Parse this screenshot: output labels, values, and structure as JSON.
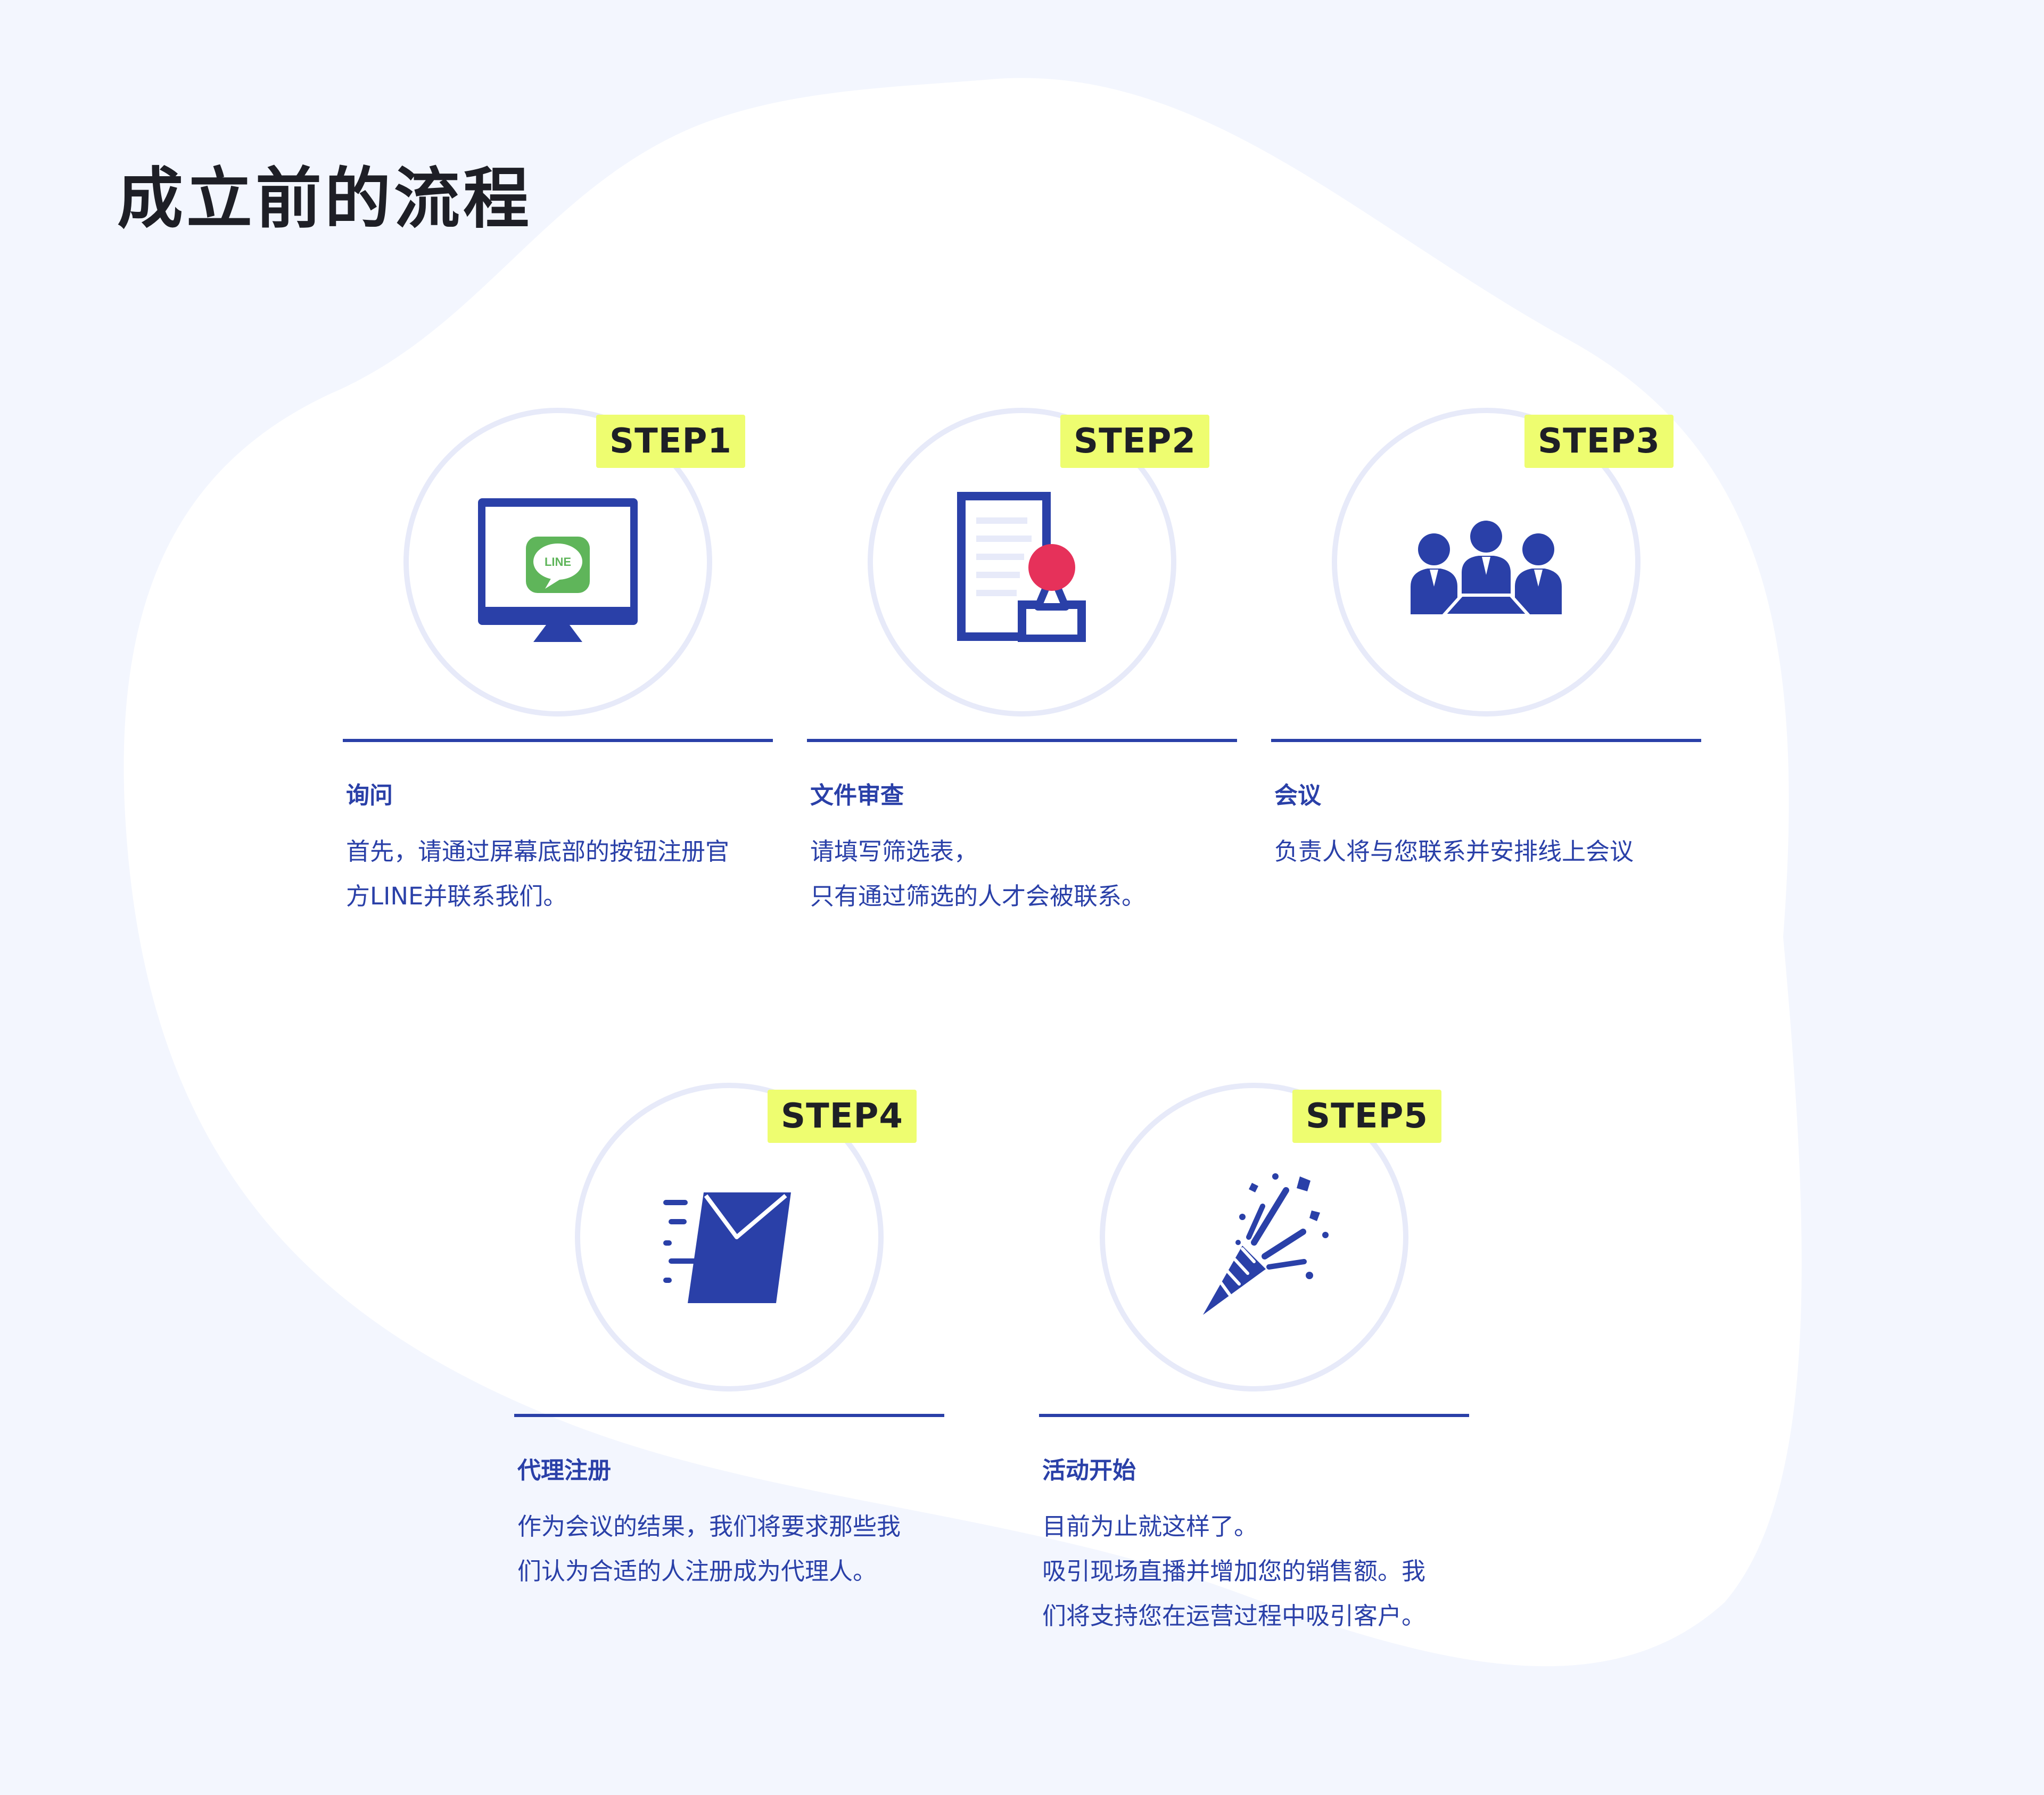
{
  "page": {
    "title": "成立前的流程"
  },
  "colors": {
    "background": "#f3f6fe",
    "blob": "#ffffff",
    "ring": "#e7eaf9",
    "accent_blue": "#2a40a8",
    "tag_yellow": "#eefd70",
    "line_green": "#5fb55a",
    "stamp_red": "#e6315a",
    "heading_dark": "#1e1f26"
  },
  "steps": [
    {
      "tag": "STEP1",
      "icon": "monitor-line-icon",
      "icon_text": "LINE",
      "title": "询问",
      "description": [
        "首先，请通过屏幕底部的按钮注册官",
        "方LINE并联系我们。"
      ]
    },
    {
      "tag": "STEP2",
      "icon": "document-stamp-icon",
      "title": "文件审查",
      "description": [
        "请填写筛选表，",
        "只有通过筛选的人才会被联系。"
      ]
    },
    {
      "tag": "STEP3",
      "icon": "meeting-people-icon",
      "title": "会议",
      "description": [
        "负责人将与您联系并安排线上会议"
      ]
    },
    {
      "tag": "STEP4",
      "icon": "sending-mail-icon",
      "title": "代理注册",
      "description": [
        "作为会议的结果，我们将要求那些我",
        "们认为合适的人注册成为代理人。"
      ]
    },
    {
      "tag": "STEP5",
      "icon": "party-popper-icon",
      "title": "活动开始",
      "description": [
        "目前为止就这样了。",
        "吸引现场直播并增加您的销售额。我",
        "们将支持您在运营过程中吸引客户。"
      ]
    }
  ]
}
